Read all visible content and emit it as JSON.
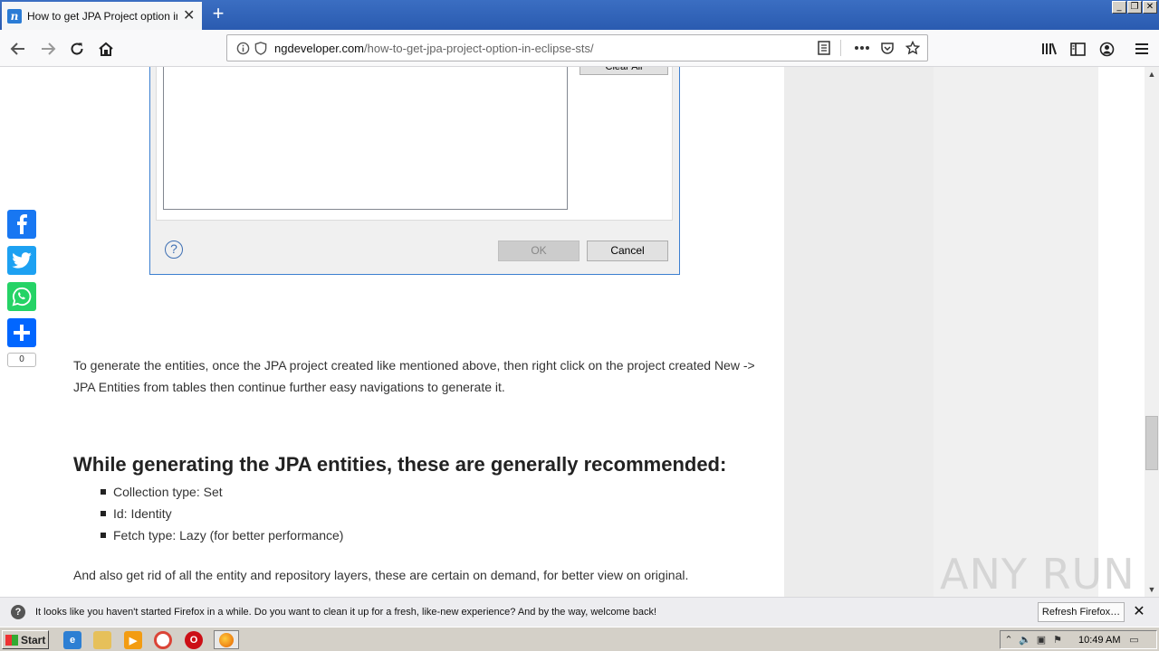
{
  "browser": {
    "tab": {
      "favicon_letter": "n",
      "title": "How to get JPA Project option in E",
      "close_glyph": "✕"
    },
    "new_tab_glyph": "+",
    "window_controls": [
      "_",
      "❐",
      "✕"
    ],
    "url": {
      "domain": "ngdeveloper.com",
      "path": "/how-to-get-jpa-project-option-in-eclipse-sts/"
    },
    "icons": {
      "back": "back-arrow-icon",
      "forward": "forward-arrow-icon",
      "reload": "reload-icon",
      "home": "home-icon",
      "info": "info-icon",
      "shield": "tracking-shield-icon",
      "reader": "reader-view-icon",
      "more": "more-actions-icon",
      "pocket": "pocket-icon",
      "bookmark": "bookmark-star-icon",
      "library": "library-icon",
      "sidebar": "sidebar-icon",
      "account": "account-icon",
      "menu": "hamburger-menu-icon"
    }
  },
  "dialog": {
    "clear_all_label": "Clear All",
    "ok_label": "OK",
    "cancel_label": "Cancel",
    "help_glyph": "?"
  },
  "share": {
    "count": "0"
  },
  "article": {
    "paragraph": "To generate the entities, once the JPA project created like mentioned above, then right click on the project created New -> JPA Entities from tables then continue further easy navigations to generate it.",
    "heading": "While generating the JPA entities, these are generally recommended:",
    "list": [
      "Collection type: Set",
      "Id: Identity",
      "Fetch type: Lazy (for better performance)"
    ],
    "cut_text": "And also get rid of all the entity and repository layers, these are certain on demand, for better view on original."
  },
  "watermark": "ANY RUN",
  "notification": {
    "message": "It looks like you haven't started Firefox in a while. Do you want to clean it up for a fresh, like-new experience? And by the way, welcome back!",
    "button_label": "Refresh Firefox…",
    "close_glyph": "✕"
  },
  "taskbar": {
    "start_label": "Start",
    "clock": "10:49 AM"
  },
  "colors": {
    "tabstrip": "#2a5bb0",
    "facebook": "#1877f2",
    "twitter": "#1da1f2",
    "whatsapp": "#25d366",
    "share": "#0166ff"
  }
}
